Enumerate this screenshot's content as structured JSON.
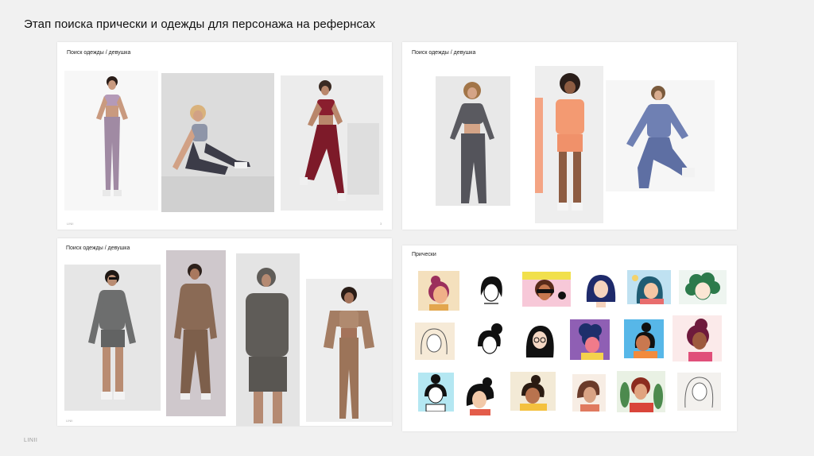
{
  "page": {
    "title": "Этап поиска прически и одежды для персонажа на рефернсах",
    "footer": "LINII"
  },
  "panels": {
    "outfits_1": {
      "label": "Поиск одежды / девушка",
      "mark_left": "LINII",
      "mark_right": "3"
    },
    "outfits_2": {
      "label": "Поиск одежды / девушка"
    },
    "outfits_3": {
      "label": "Поиск одежды / девушка",
      "mark_left": "LINII"
    },
    "hairstyles": {
      "label": "Прически"
    }
  },
  "colors": {
    "lilac_set": "#a08aa3",
    "grey_set": "#8e95a8",
    "burgundy_set": "#8a1e2e",
    "charcoal_set": "#5a5a60",
    "peach_set": "#f39a72",
    "blue_set": "#6f80b3",
    "olive_grey_set": "#6d6e6e",
    "brown_set": "#8a6a55",
    "dark_grey_set": "#5f5c58",
    "tan_set": "#a47d63"
  }
}
